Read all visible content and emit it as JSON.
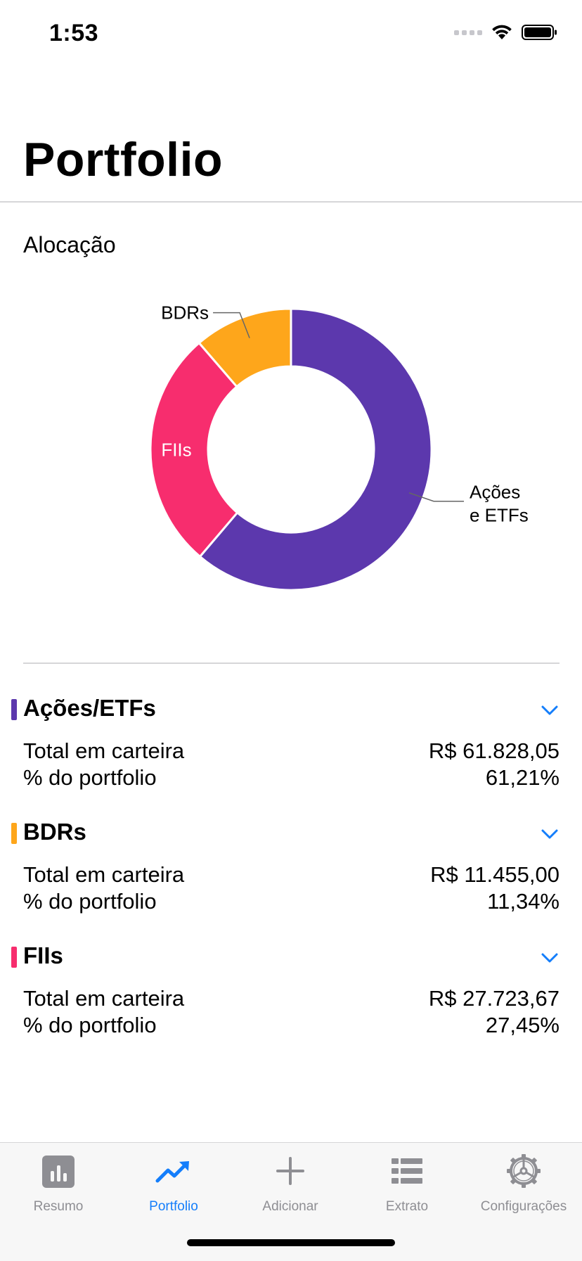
{
  "status_bar": {
    "time": "1:53"
  },
  "header": {
    "title": "Portfolio"
  },
  "allocation": {
    "title": "Alocação",
    "chart_data": {
      "type": "pie",
      "categories": [
        "Ações e ETFs",
        "FIIs",
        "BDRs"
      ],
      "values": [
        61.21,
        27.45,
        11.34
      ],
      "colors": [
        "#5c38ad",
        "#f72d6e",
        "#fea61b"
      ],
      "labels": [
        "Ações\ne ETFs",
        "FIIs",
        "BDRs"
      ],
      "donut": true
    }
  },
  "groups": [
    {
      "name": "Ações/ETFs",
      "color": "#5c38ad",
      "total_label": "Total em carteira",
      "total_value": "R$ 61.828,05",
      "pct_label": "% do portfolio",
      "pct_value": "61,21%"
    },
    {
      "name": "BDRs",
      "color": "#fea61b",
      "total_label": "Total em carteira",
      "total_value": "R$ 11.455,00",
      "pct_label": "% do portfolio",
      "pct_value": "11,34%"
    },
    {
      "name": "FIIs",
      "color": "#f72d6e",
      "total_label": "Total em carteira",
      "total_value": "R$ 27.723,67",
      "pct_label": "% do portfolio",
      "pct_value": "27,45%"
    }
  ],
  "tabs": [
    {
      "label": "Resumo",
      "icon": "chart-bar-icon",
      "active": false
    },
    {
      "label": "Portfolio",
      "icon": "trend-up-icon",
      "active": true
    },
    {
      "label": "Adicionar",
      "icon": "plus-icon",
      "active": false
    },
    {
      "label": "Extrato",
      "icon": "list-icon",
      "active": false
    },
    {
      "label": "Configurações",
      "icon": "gear-icon",
      "active": false
    }
  ],
  "colors": {
    "accent": "#147efb",
    "inactive": "#8e8e93"
  }
}
